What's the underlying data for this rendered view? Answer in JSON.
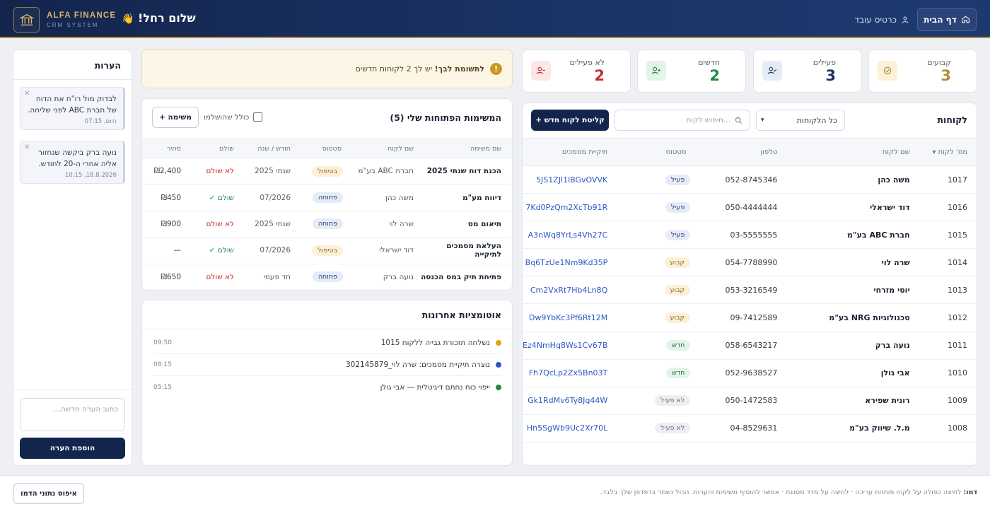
{
  "header": {
    "home_label": "דף הבית",
    "employee_card_label": "כרטיס עובד",
    "brand_name": "ALFA FINANCE",
    "brand_sub": "CRM SYSTEM",
    "greeting": "שלום רחל!",
    "greeting_emoji": "👋"
  },
  "stats": [
    {
      "label": "קבועים",
      "value": "3",
      "color": "#b08d3e"
    },
    {
      "label": "פעילים",
      "value": "3",
      "color": "#1b2f5c"
    },
    {
      "label": "חדשים",
      "value": "2",
      "color": "#1d8a4c"
    },
    {
      "label": "לא פעילים",
      "value": "2",
      "color": "#c62f2f"
    }
  ],
  "customers": {
    "title": "לקוחות",
    "new_button": "+ קליטת לקוח חדש",
    "search_placeholder": "חיפוש לקוח...",
    "filter_value": "כל הלקוחות",
    "columns": {
      "num": "מס' לקוח ▾",
      "name": "שם לקוח",
      "phone": "טלפון",
      "status": "סטטוס",
      "folder": "תיקיית מסמכים"
    },
    "rows": [
      {
        "num": "1017",
        "name": "משה כהן",
        "phone": "052-8745346",
        "status": "פעיל",
        "kind": "active",
        "folder": "5JS1ZJl1lBGvOVVK"
      },
      {
        "num": "1016",
        "name": "דוד ישראלי",
        "phone": "050-4444444",
        "status": "פעיל",
        "kind": "active",
        "folder": "7Kd0PzQm2XcTb91R"
      },
      {
        "num": "1015",
        "name": "חברת ABC בע\"מ",
        "phone": "03-5555555",
        "status": "פעיל",
        "kind": "active",
        "folder": "A3nWq8YrLs4Vh27C"
      },
      {
        "num": "1014",
        "name": "שרה לוי",
        "phone": "054-7788990",
        "status": "קבוע",
        "kind": "fixed",
        "folder": "Bq6TzUe1Nm9Kd35P"
      },
      {
        "num": "1013",
        "name": "יוסי מזרחי",
        "phone": "053-3216549",
        "status": "קבוע",
        "kind": "fixed",
        "folder": "Cm2VxRt7Hb4Ln8Q"
      },
      {
        "num": "1012",
        "name": "טכנולוגיות NRG בע\"מ",
        "phone": "09-7412589",
        "status": "קבוע",
        "kind": "fixed",
        "folder": "Dw9YbKc3Pf6Rt12M"
      },
      {
        "num": "1011",
        "name": "נועה ברק",
        "phone": "058-6543217",
        "status": "חדש",
        "kind": "new",
        "folder": "Ez4NmHq8Ws1Cv67B"
      },
      {
        "num": "1010",
        "name": "אבי גולן",
        "phone": "052-9638527",
        "status": "חדש",
        "kind": "new",
        "folder": "Fh7QcLp2Zx5Bn03T"
      },
      {
        "num": "1009",
        "name": "רונית שפירא",
        "phone": "050-1472583",
        "status": "לא פעיל",
        "kind": "inactive",
        "folder": "Gk1RdMv6Ty8Jq44W"
      },
      {
        "num": "1008",
        "name": "מ.ל. שיווק בע\"מ",
        "phone": "04-8529631",
        "status": "לא פעיל",
        "kind": "inactive",
        "folder": "Hn5SgWb9Uc2Xr70L"
      }
    ]
  },
  "alert": {
    "bold": "לתשומת לבך!",
    "text": " יש לך 2 לקוחות חדשים"
  },
  "tasks": {
    "title": "המשימות הפתוחות שלי (5)",
    "include_done_label": "כולל שהושלמו",
    "add_button": "+ משימה",
    "columns": {
      "task": "שם משימה",
      "client": "שם לקוח",
      "status": "סטטוס",
      "period": "חודש / שנה",
      "paid": "שולם",
      "price": "מחיר"
    },
    "rows": [
      {
        "task": "הכנת דוח שנתי 2025",
        "client": "חברת ABC בע\"מ",
        "status": "בטיפול",
        "kind": "handle",
        "period": "שנתי 2025",
        "paid": "לא שולם",
        "paid_kind": "unpaid",
        "price": "₪2,400"
      },
      {
        "task": "דיווח מע\"מ",
        "client": "משה כהן",
        "status": "פתוחה",
        "kind": "open",
        "period": "07/2026",
        "paid": "שולם ✓",
        "paid_kind": "paid",
        "price": "₪450"
      },
      {
        "task": "תיאום מס",
        "client": "שרה לוי",
        "status": "פתוחה",
        "kind": "open",
        "period": "שנתי 2025",
        "paid": "לא שולם",
        "paid_kind": "unpaid",
        "price": "₪900"
      },
      {
        "task": "העלאת מסמכים לתיקייה",
        "client": "דוד ישראלי",
        "status": "בטיפול",
        "kind": "handle",
        "period": "07/2026",
        "paid": "שולם ✓",
        "paid_kind": "paid",
        "price": "—"
      },
      {
        "task": "פתיחת תיק במס הכנסה",
        "client": "נועה ברק",
        "status": "פתוחה",
        "kind": "open",
        "period": "חד פעמי",
        "paid": "לא שולם",
        "paid_kind": "unpaid",
        "price": "₪650"
      }
    ]
  },
  "automations": {
    "title": "אוטומציות אחרונות",
    "items": [
      {
        "text": "נשלחה תזכורת גבייה ללקוח 1015",
        "time": "09:50",
        "color": "#e0a21a"
      },
      {
        "text": "נוצרה תיקיית מסמכים: שרה לוי_302145879",
        "time": "08:15",
        "color": "#2c56c4"
      },
      {
        "text": "ייפוי כוח נחתם דיגיטלית — אבי גולן",
        "time": "05:15",
        "color": "#1d8a4c"
      }
    ]
  },
  "notes": {
    "title": "הערות",
    "items": [
      {
        "text": "לבדוק מול רו\"ח את הדוח של חברת ABC לפני שליחה.",
        "date": "היום, 07:15"
      },
      {
        "text": "נועה ברק ביקשה שנחזור אליה אחרי ה-20 לחודש.",
        "date": "18.8.2026, 10:15"
      }
    ],
    "input_placeholder": "כתוב הערה חדשה...",
    "add_button": "הוספת הערה"
  },
  "footer": {
    "tip_bold": "דמו:",
    "tip_text": " לחיצה כפולה על לקוח פותחת עריכה · לחיצה על מדד מסננת · אפשר להוסיף משימות והערות. הכול נשמר בדפדפן שלך בלבד.",
    "reset_button": "איפוס נתוני הדמו"
  }
}
